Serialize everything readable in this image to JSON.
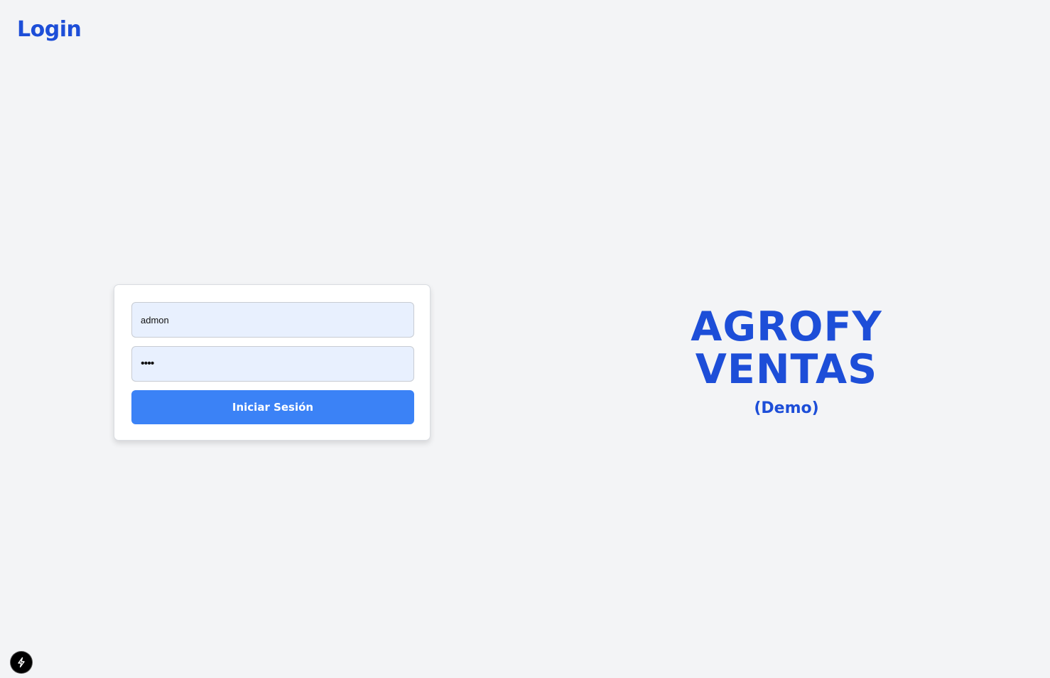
{
  "header": {
    "title": "Login"
  },
  "login_form": {
    "username_value": "admon",
    "password_value": "pass",
    "submit_label": "Iniciar Sesión"
  },
  "brand": {
    "line1": "AGROFY",
    "line2": "VENTAS",
    "subtitle": "(Demo)"
  },
  "dev_badge": {
    "icon": "lightning-bolt-icon"
  },
  "colors": {
    "background": "#f3f4f6",
    "accent_text": "#1d4ed8",
    "button": "#3b82f6",
    "input_fill": "#e8f0fe"
  }
}
